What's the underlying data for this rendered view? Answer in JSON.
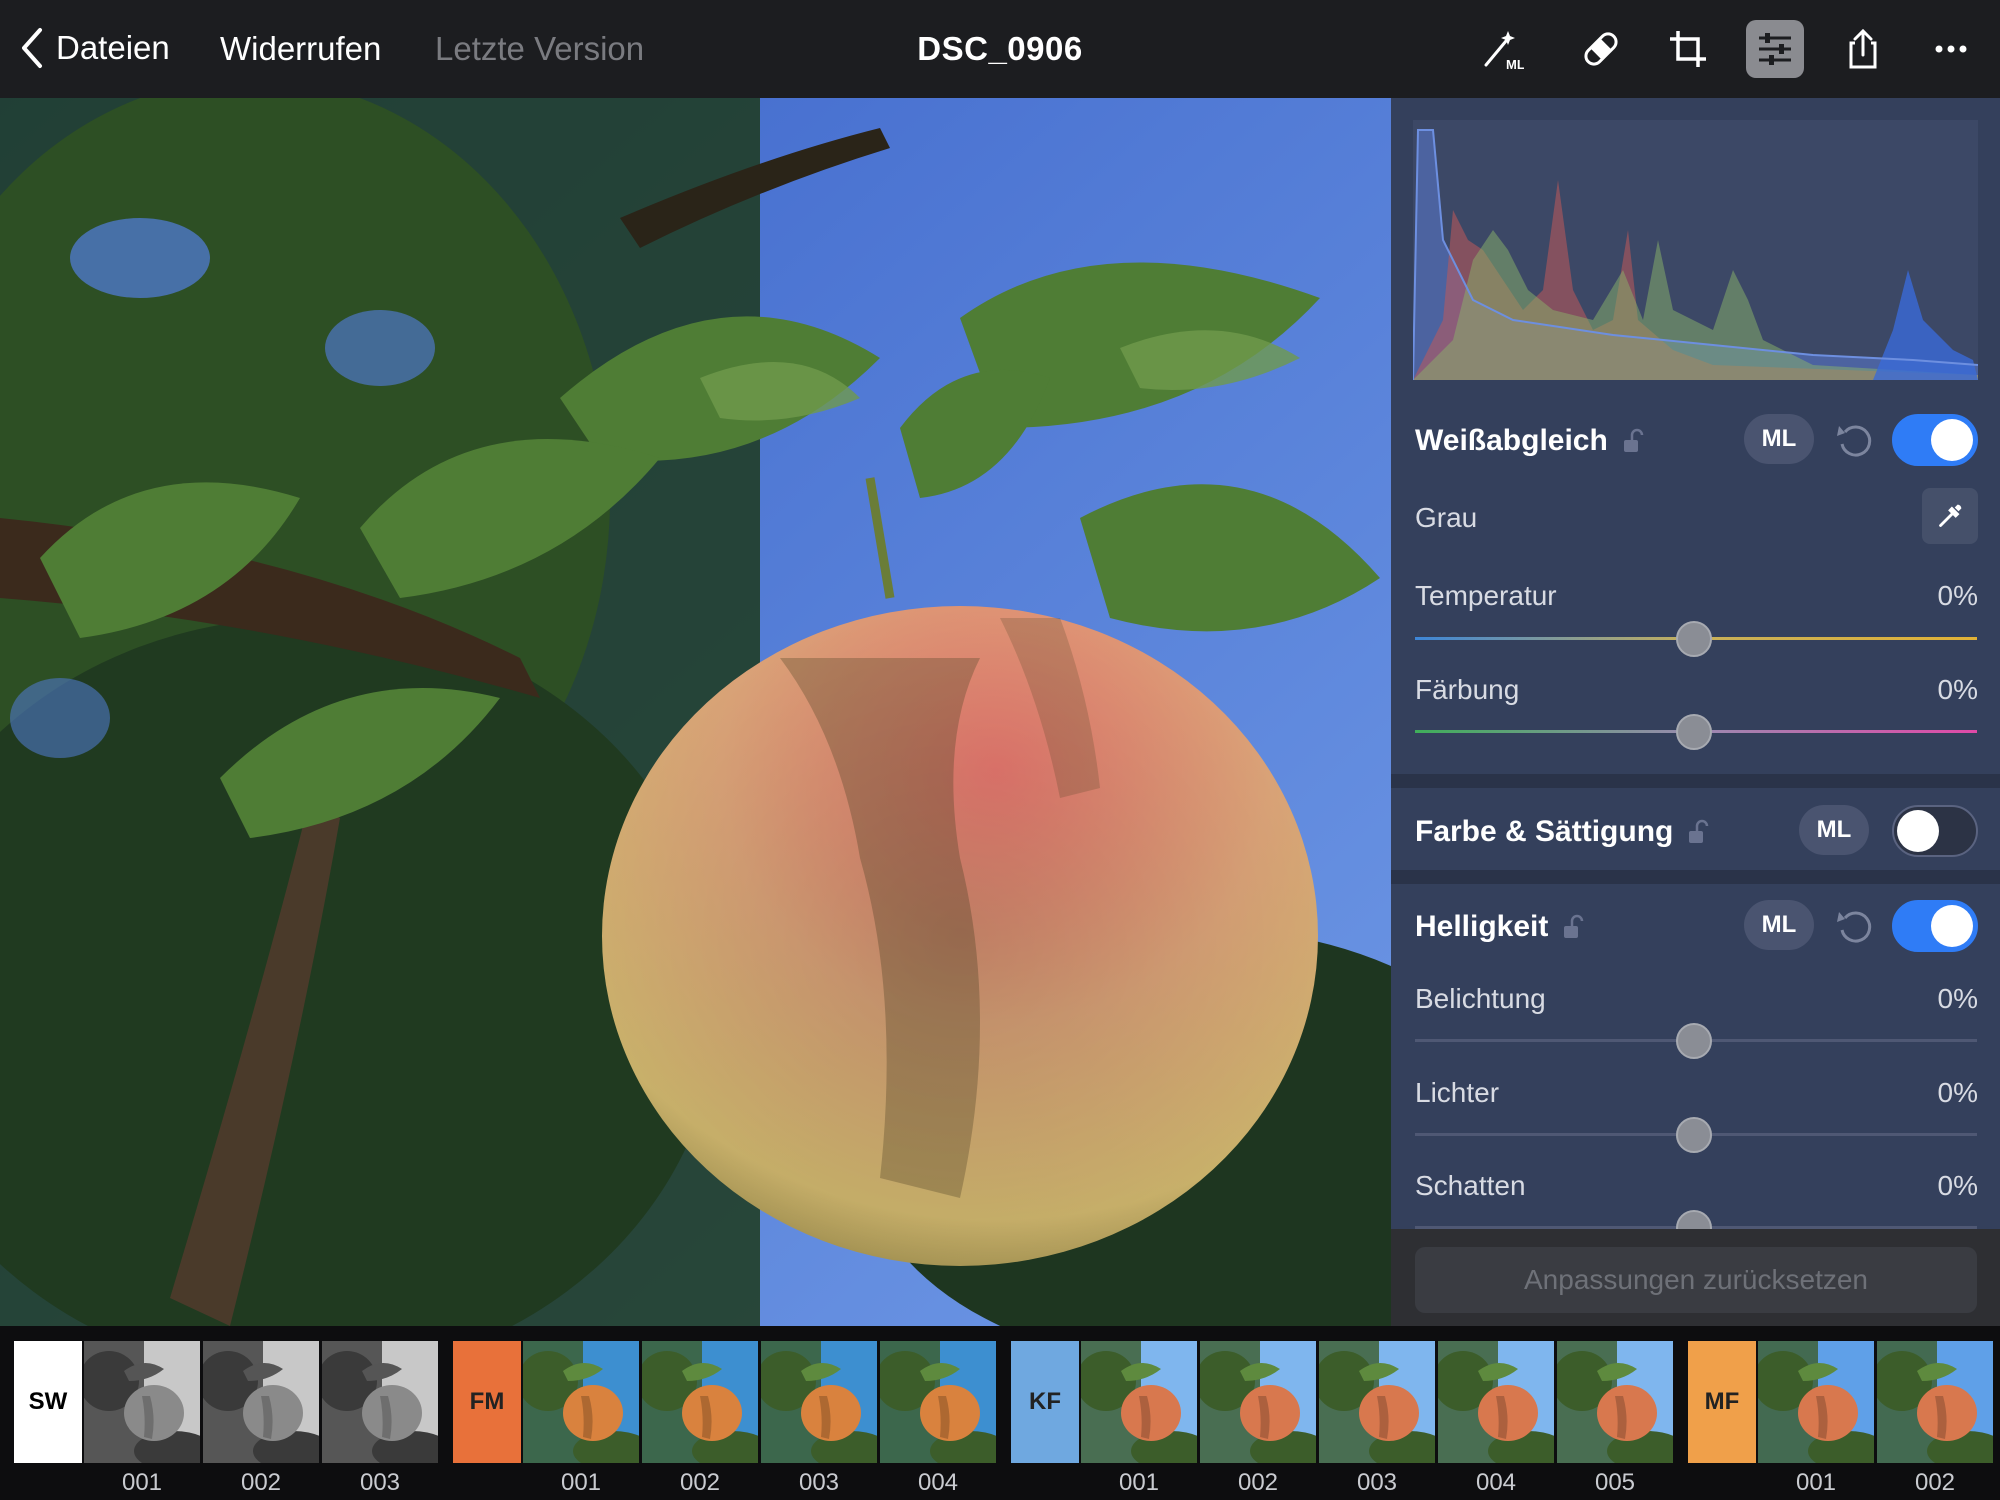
{
  "topbar": {
    "back_label": "Dateien",
    "undo_label": "Widerrufen",
    "last_version_label": "Letzte Version",
    "title": "DSC_0906",
    "tools": [
      "ml-magic-icon",
      "healing-bandage-icon",
      "crop-icon",
      "adjustments-icon",
      "share-icon",
      "more-icon"
    ]
  },
  "panel": {
    "white_balance": {
      "title": "Weißabgleich",
      "ml_label": "ML",
      "enabled": true,
      "gray_label": "Grau",
      "temperature_label": "Temperatur",
      "temperature_value": "0%",
      "tint_label": "Färbung",
      "tint_value": "0%"
    },
    "color_saturation": {
      "title": "Farbe & Sättigung",
      "ml_label": "ML",
      "enabled": false
    },
    "brightness": {
      "title": "Helligkeit",
      "ml_label": "ML",
      "enabled": true,
      "exposure_label": "Belichtung",
      "exposure_value": "0%",
      "highlights_label": "Lichter",
      "highlights_value": "0%",
      "shadows_label": "Schatten",
      "shadows_value": "0%"
    },
    "reset_all_label": "Anpassungen zurücksetzen"
  },
  "filmstrip": {
    "groups": [
      {
        "tag": "SW",
        "color": "#ffffff",
        "text_color": "#000000",
        "items": [
          "001",
          "002",
          "003"
        ]
      },
      {
        "tag": "FM",
        "color": "#e8713a",
        "text_color": "#222222",
        "items": [
          "001",
          "002",
          "003",
          "004"
        ]
      },
      {
        "tag": "KF",
        "color": "#6fa8e0",
        "text_color": "#222222",
        "items": [
          "001",
          "002",
          "003",
          "004",
          "005"
        ]
      },
      {
        "tag": "MF",
        "color": "#f0a04a",
        "text_color": "#222222",
        "items": [
          "001",
          "002"
        ]
      }
    ]
  },
  "colors": {
    "accent": "#2f7cf6",
    "panel_bg": "#34405c",
    "topbar_bg": "#1c1d20"
  }
}
